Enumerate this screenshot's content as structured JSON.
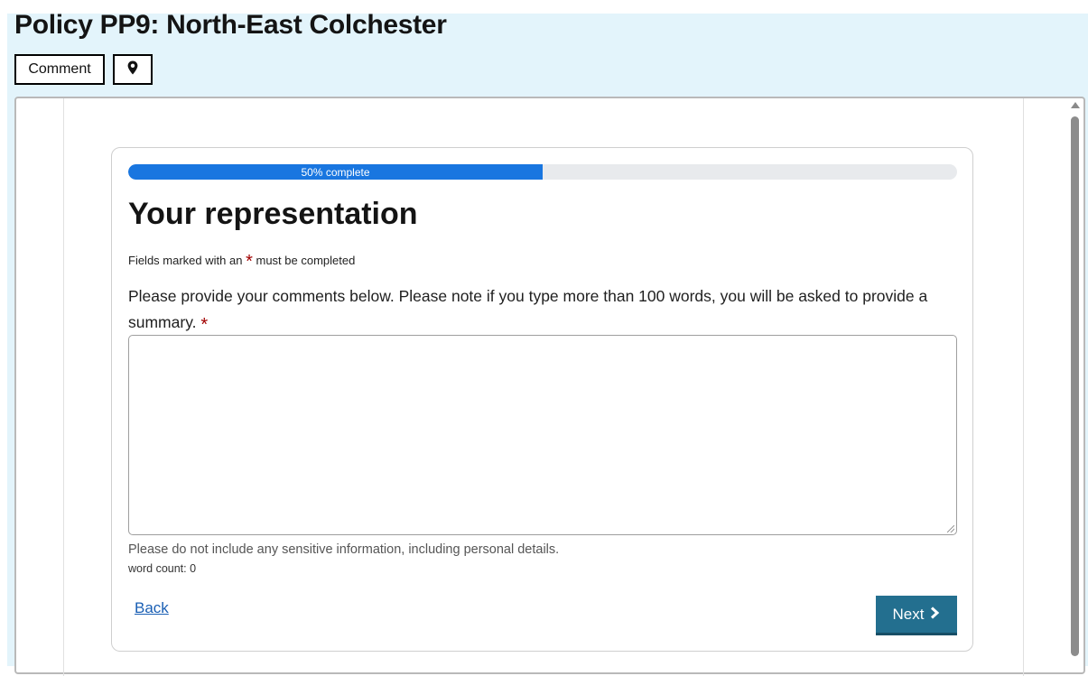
{
  "header": {
    "title": "Policy PP9: North-East Colchester",
    "comment_label": "Comment",
    "location_icon": "map-pin-icon"
  },
  "form": {
    "progress_percent": 50,
    "progress_label": "50% complete",
    "heading": "Your representation",
    "required_note_prefix": "Fields marked with an",
    "required_note_star": "*",
    "required_note_suffix": "must be completed",
    "question": "Please provide your comments below. Please note if you type more than 100 words, you will be asked to provide a summary.",
    "question_star": "*",
    "textarea_value": "",
    "hint": "Please do not include any sensitive information, including personal details.",
    "word_count": "word count: 0",
    "back_label": "Back",
    "next_label": "Next",
    "next_icon": "chevron-right-icon"
  },
  "colors": {
    "header_band": "#e3f4fb",
    "progress_fill": "#1976e0",
    "next_button": "#236f8f",
    "required_star": "#a10000",
    "link": "#1a5fb4"
  }
}
